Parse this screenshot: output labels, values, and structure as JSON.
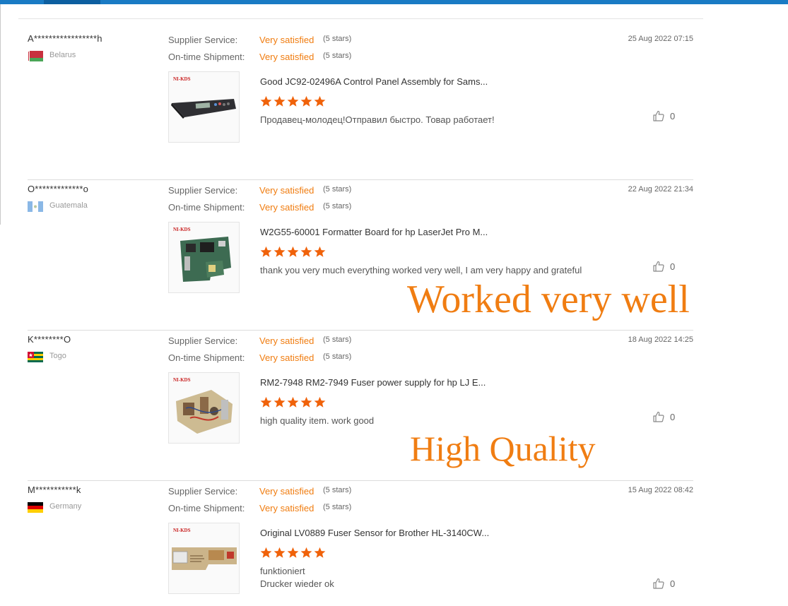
{
  "labels": {
    "supplier_service": "Supplier Service:",
    "ontime_shipment": "On-time Shipment:"
  },
  "colors": {
    "accent": "#f07c0f",
    "star": "#f0620a",
    "topbar": "#1a7bc4",
    "overlay_text": "#f07d12"
  },
  "reviews": [
    {
      "buyer": "A*****************h",
      "country": "Belarus",
      "flag": "belarus-flag",
      "supplier_service": {
        "value": "Very satisfied",
        "stars": "(5 stars)"
      },
      "ontime_shipment": {
        "value": "Very satisfied",
        "stars": "(5 stars)"
      },
      "date": "25 Aug 2022 07:15",
      "product_title": "Good JC92-02496A Control Panel Assembly for Sams...",
      "brand": "NI-KDS",
      "rating": 5,
      "feedback": "Продавец-молодец!Отправил быстро. Товар работает!",
      "likes": "0"
    },
    {
      "buyer": "O*************o",
      "country": "Guatemala",
      "flag": "guatemala-flag",
      "supplier_service": {
        "value": "Very satisfied",
        "stars": "(5 stars)"
      },
      "ontime_shipment": {
        "value": "Very satisfied",
        "stars": "(5 stars)"
      },
      "date": "22 Aug 2022 21:34",
      "product_title": "W2G55-60001 Formatter Board for hp LaserJet Pro M...",
      "brand": "NI-KDS",
      "rating": 5,
      "feedback": "thank you very much everything worked very well, I am very happy and grateful",
      "likes": "0"
    },
    {
      "buyer": "K********O",
      "country": "Togo",
      "flag": "togo-flag",
      "supplier_service": {
        "value": "Very satisfied",
        "stars": "(5 stars)"
      },
      "ontime_shipment": {
        "value": "Very satisfied",
        "stars": "(5 stars)"
      },
      "date": "18 Aug 2022 14:25",
      "product_title": "RM2-7948 RM2-7949 Fuser power supply for hp LJ E...",
      "brand": "NI-KDS",
      "rating": 5,
      "feedback": "high quality item. work good",
      "likes": "0"
    },
    {
      "buyer": "M***********k",
      "country": "Germany",
      "flag": "germany-flag",
      "supplier_service": {
        "value": "Very satisfied",
        "stars": "(5 stars)"
      },
      "ontime_shipment": {
        "value": "Very satisfied",
        "stars": "(5 stars)"
      },
      "date": "15 Aug 2022 08:42",
      "product_title": "Original LV0889 Fuser Sensor for Brother HL-3140CW...",
      "brand": "NI-KDS",
      "rating": 5,
      "feedback_line1": "funktioniert",
      "feedback_line2": "Drucker wieder ok",
      "likes": "0"
    }
  ],
  "overlays": {
    "worked_very_well": "Worked very well",
    "high_quality": "High Quality"
  }
}
